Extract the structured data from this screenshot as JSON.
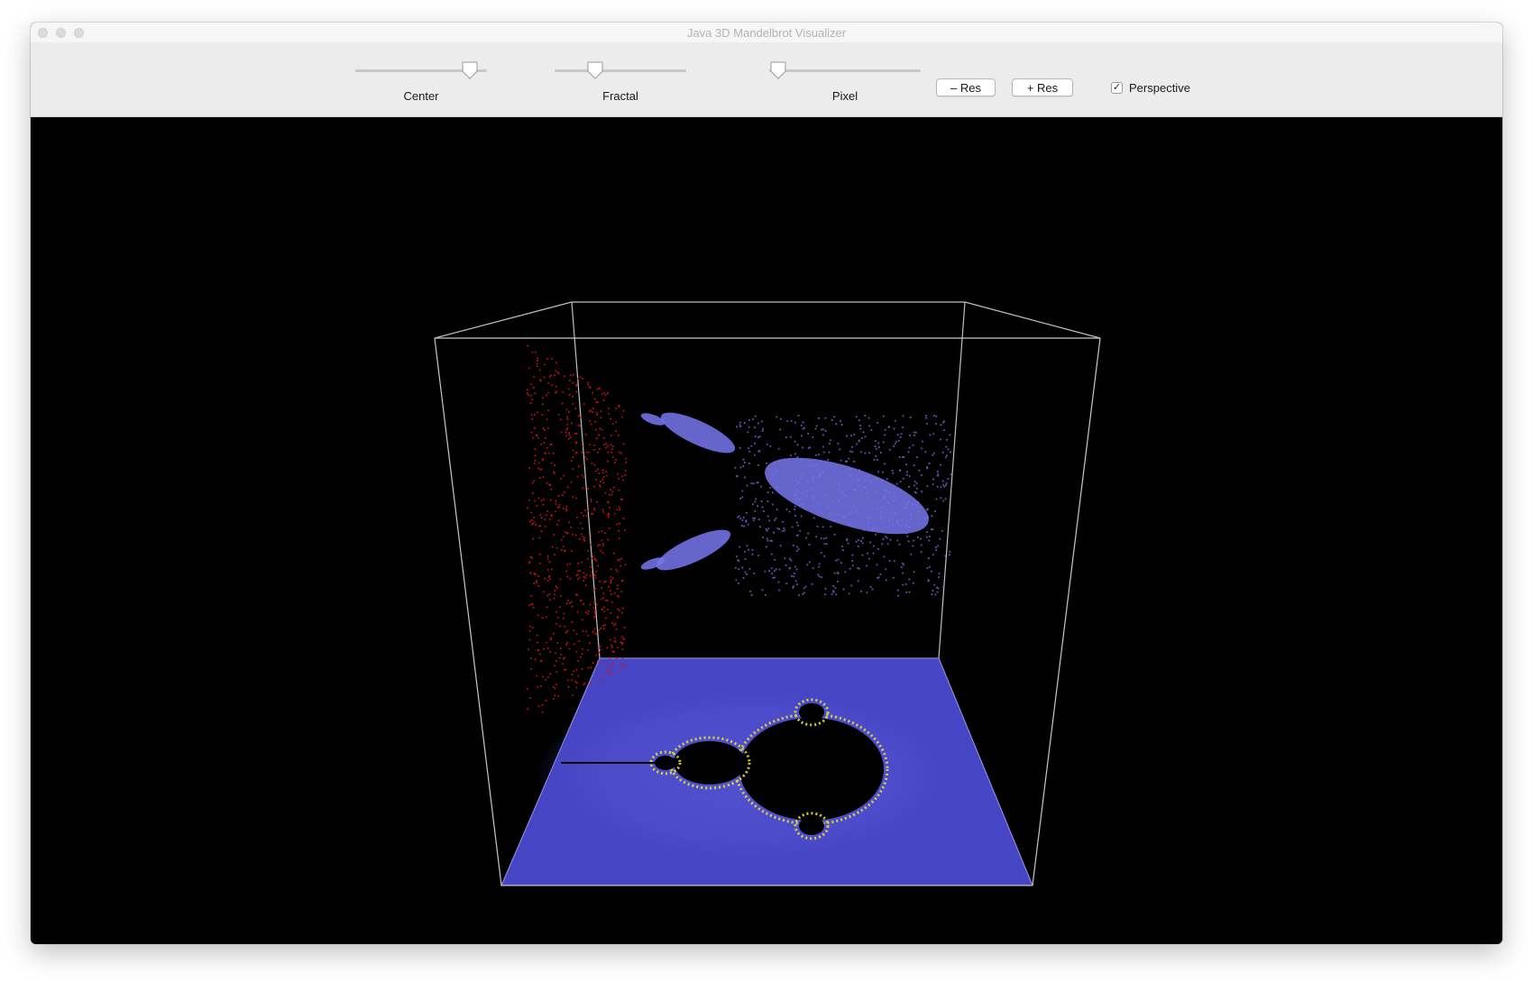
{
  "window": {
    "title": "Java 3D Mandelbrot Visualizer"
  },
  "toolbar": {
    "sliders": [
      {
        "label": "Center",
        "value": 0.93
      },
      {
        "label": "Fractal",
        "value": 0.28
      },
      {
        "label": "Pixel",
        "value": 0.0
      }
    ],
    "decrease_res_label": "– Res",
    "increase_res_label": "+ Res",
    "perspective_label": "Perspective",
    "perspective_checked": true
  },
  "colors": {
    "viewport_background": "#000000",
    "floor_plane": "#4545c6",
    "orbit_points": "#7777ee",
    "chaos_points": "#dd1111",
    "fractal_edge": "#e8e030",
    "box_edges": "#bfbfbf"
  },
  "icons": {
    "checkbox": "checkmark-icon"
  }
}
